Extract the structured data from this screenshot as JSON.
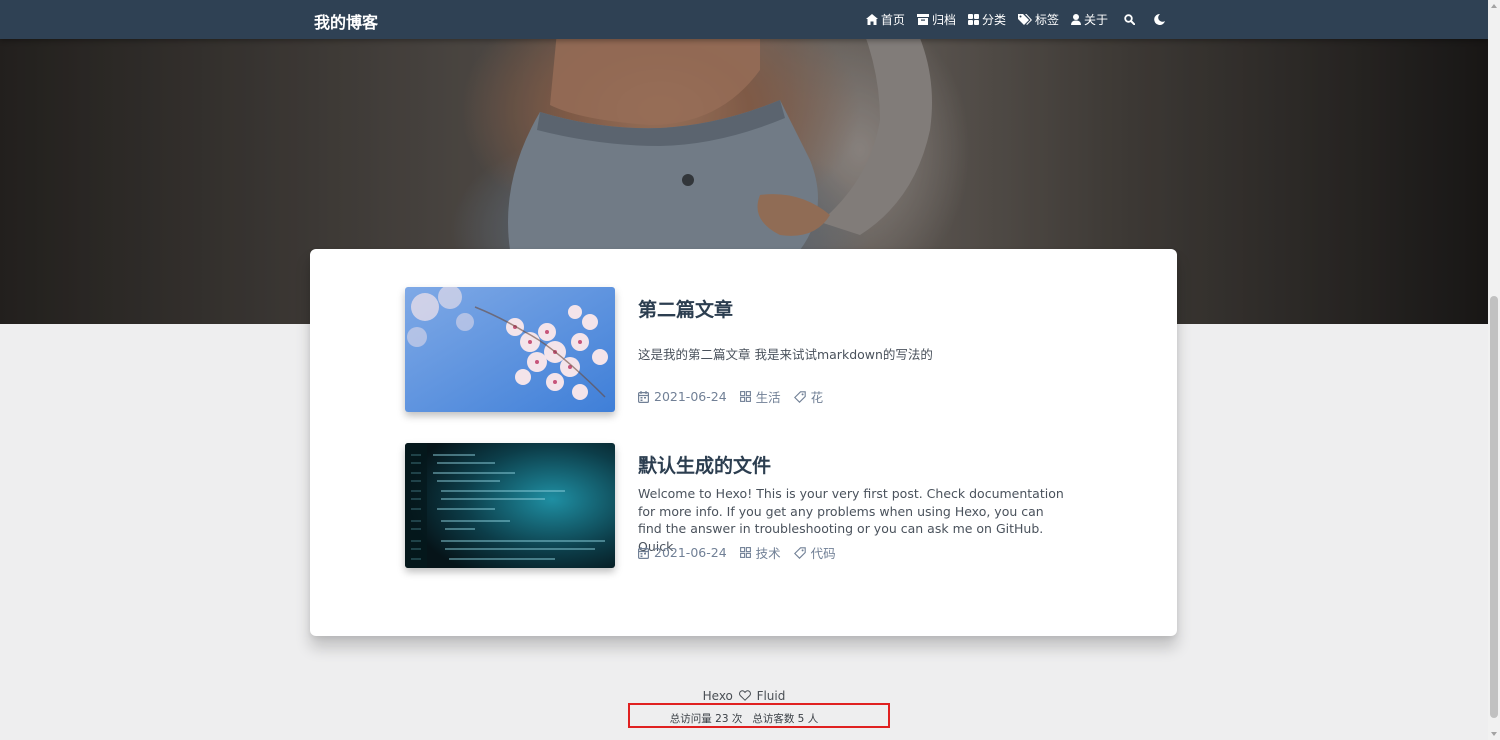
{
  "navbar": {
    "brand": "我的博客",
    "items": [
      {
        "label": "首页",
        "icon": "home-icon"
      },
      {
        "label": "归档",
        "icon": "archive-icon"
      },
      {
        "label": "分类",
        "icon": "category-grid-icon"
      },
      {
        "label": "标签",
        "icon": "tags-icon"
      },
      {
        "label": "关于",
        "icon": "user-icon"
      }
    ],
    "search_icon": "search-icon",
    "theme_icon": "moon-icon"
  },
  "posts": [
    {
      "title": "第二篇文章",
      "excerpt": "这是我的第二篇文章 我是来试试markdown的写法的",
      "date": "2021-06-24",
      "category": "生活",
      "tag": "花",
      "thumbnail": "cherry-blossom-image"
    },
    {
      "title": "默认生成的文件",
      "excerpt": "Welcome to Hexo! This is your very first post. Check documentation for more info. If you get any problems when using Hexo, you can find the answer in troubleshooting or you can ask me on GitHub. Quick",
      "date": "2021-06-24",
      "category": "技术",
      "tag": "代码",
      "thumbnail": "code-editor-image"
    }
  ],
  "footer": {
    "brand_left": "Hexo",
    "brand_right": "Fluid",
    "stats": "总访问量 23 次   总访客数 5 人"
  },
  "colors": {
    "navbar": "#2f4154",
    "page_background": "#eeeeef",
    "highlight_box": "#e02020",
    "title": "#2c3e50",
    "meta": "#718096"
  }
}
